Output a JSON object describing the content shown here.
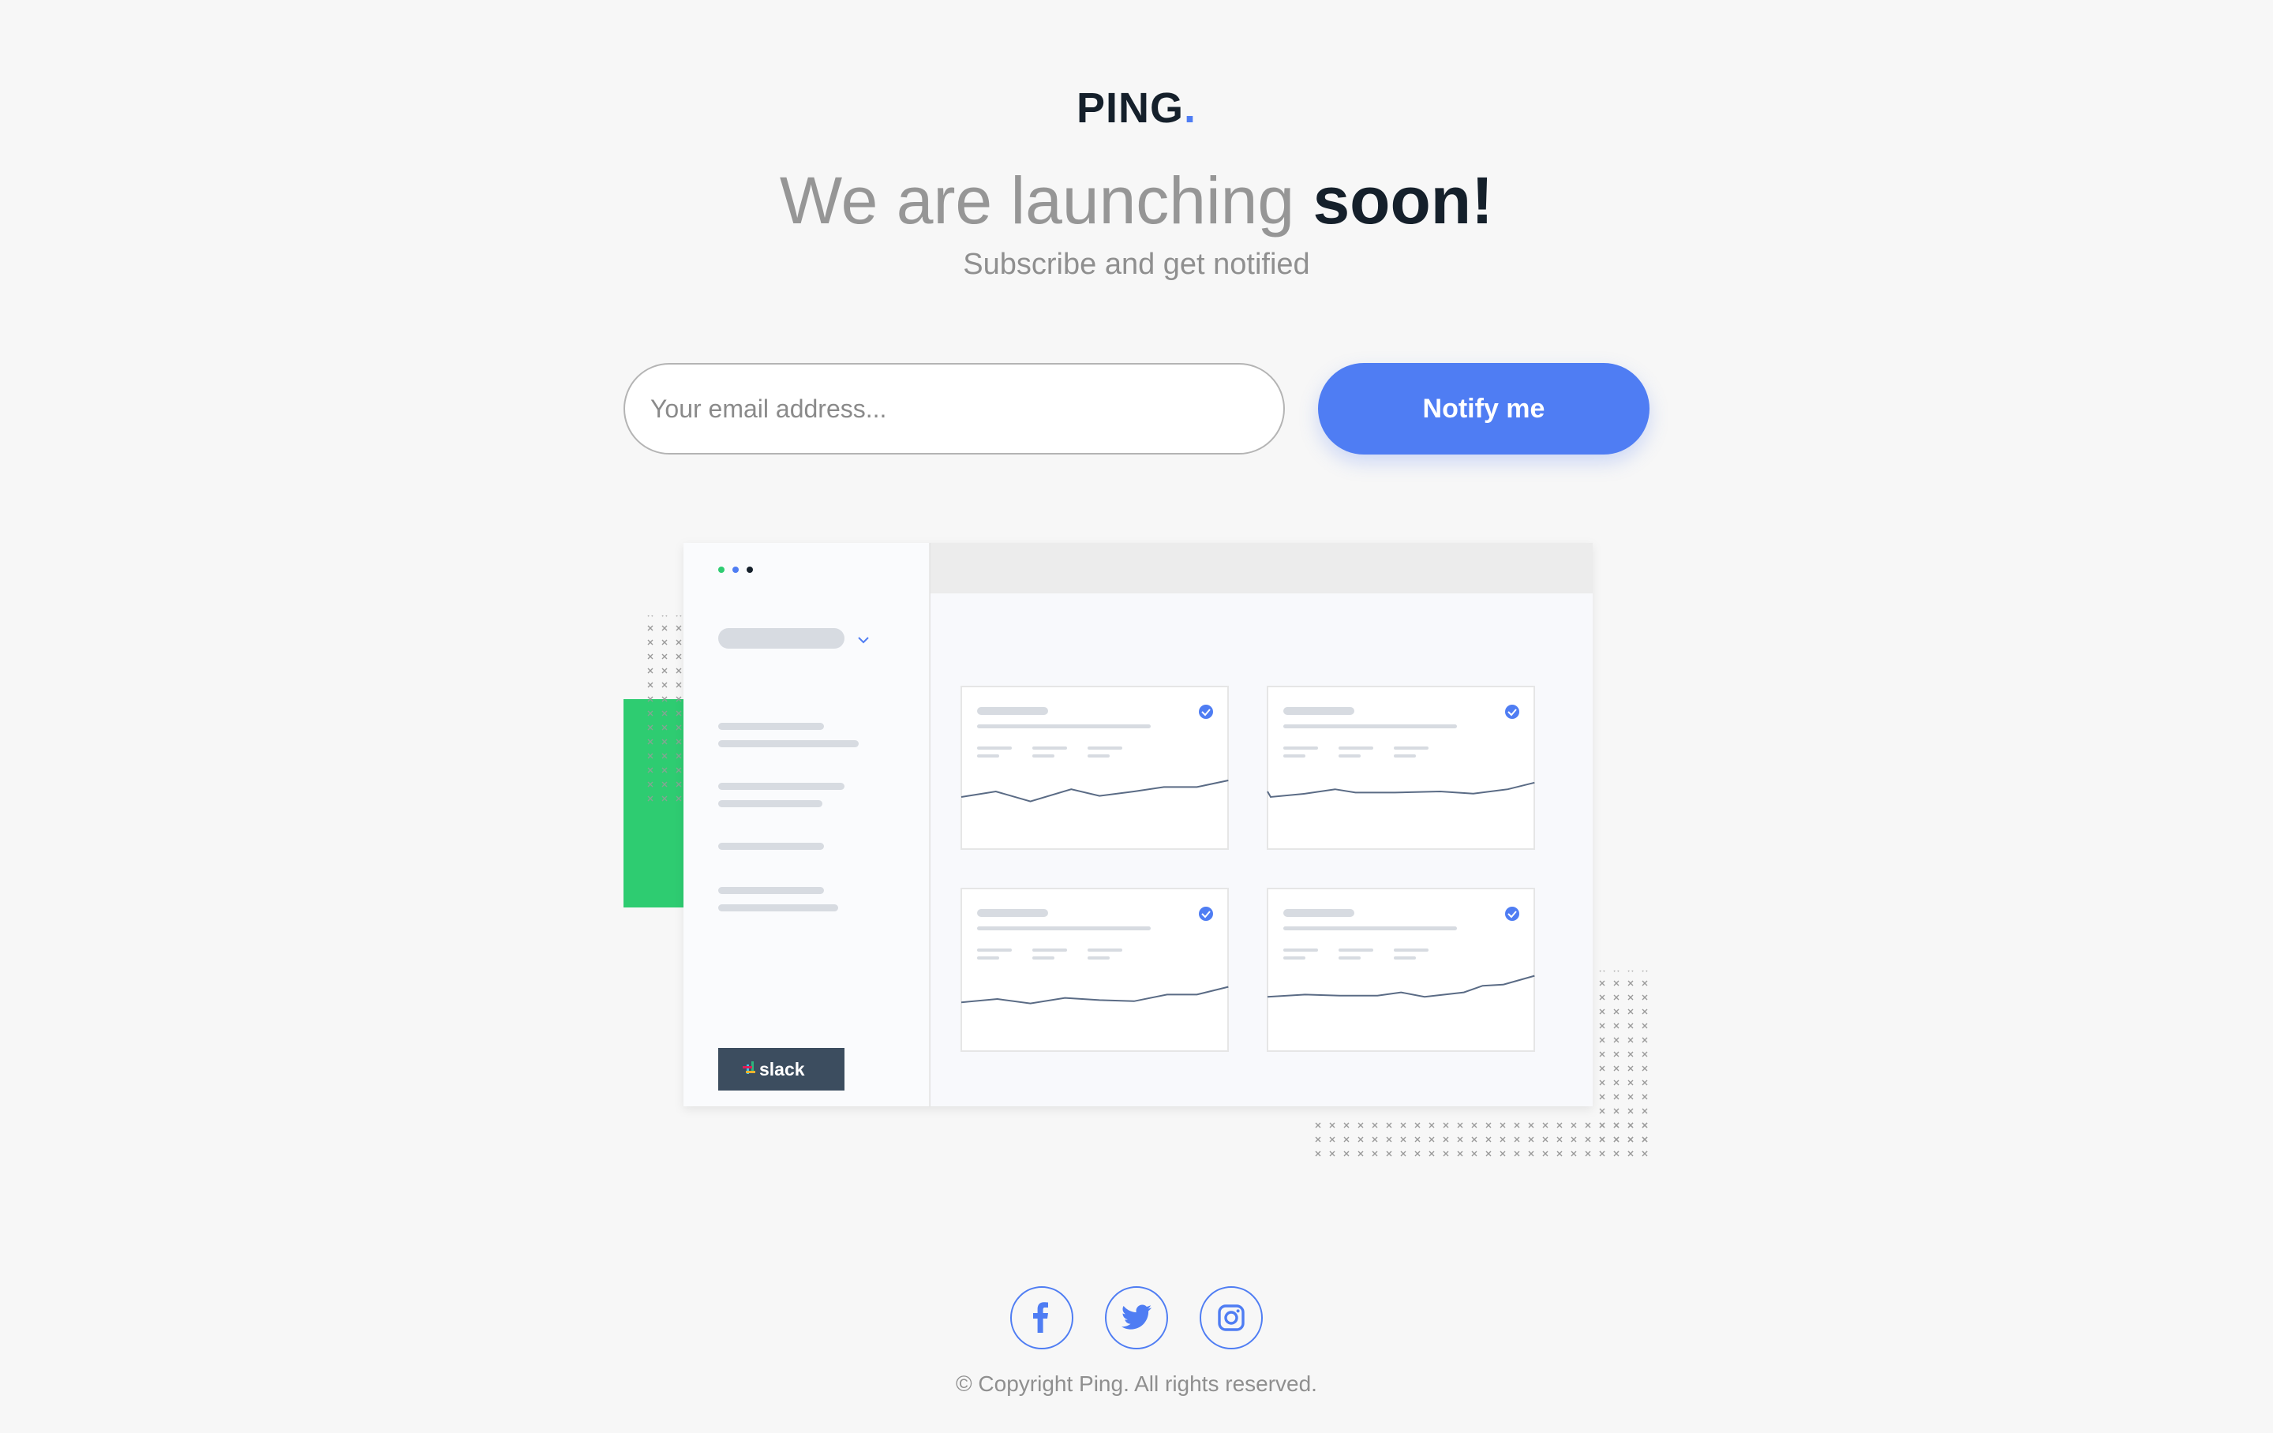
{
  "brand": {
    "name": "PING",
    "dot": ".",
    "accent": "#4f7df3",
    "dark": "#15202b"
  },
  "hero": {
    "headline_light": "We are launching",
    "headline_strong": "soon!",
    "subline": "Subscribe and get notified"
  },
  "form": {
    "email_placeholder": "Your email address...",
    "notify_label": "Notify me"
  },
  "illustration": {
    "sidebar_badge": "slack",
    "window_dots": [
      "#2ecc71",
      "#4f7df3",
      "#15202b"
    ]
  },
  "social": {
    "facebook": "facebook-icon",
    "twitter": "twitter-icon",
    "instagram": "instagram-icon"
  },
  "footer": {
    "copyright": "© Copyright Ping. All rights reserved."
  }
}
